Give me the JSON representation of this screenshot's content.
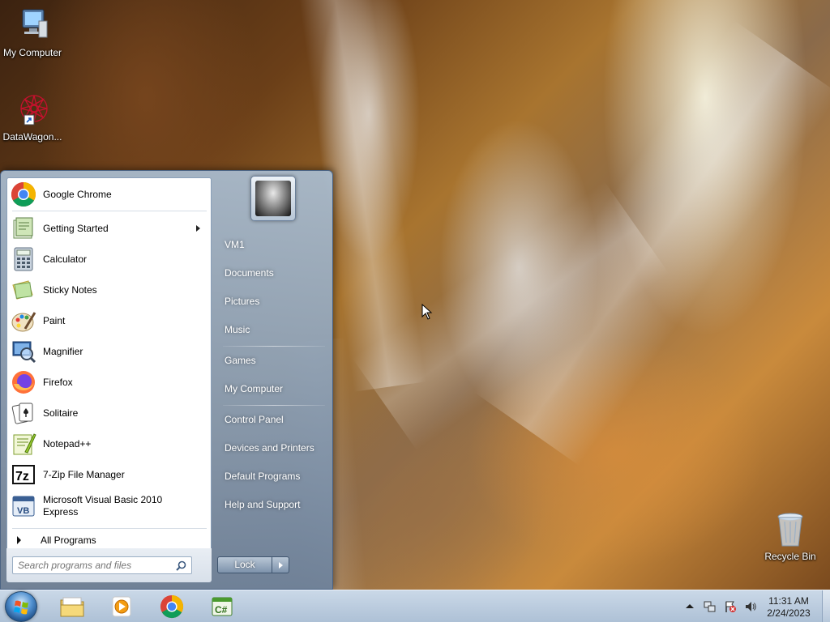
{
  "desktop": {
    "icons": [
      {
        "label": "My Computer",
        "icon": "computer-icon"
      },
      {
        "label": "DataWagon...",
        "icon": "datawagon-shortcut-icon"
      },
      {
        "label": "Recycle Bin",
        "icon": "recycle-bin-icon"
      }
    ]
  },
  "start_menu": {
    "programs": [
      {
        "label": "Google Chrome",
        "icon": "chrome-icon",
        "submenu": false
      },
      {
        "label": "Getting Started",
        "icon": "getting-started-icon",
        "submenu": true
      },
      {
        "label": "Calculator",
        "icon": "calculator-icon",
        "submenu": false
      },
      {
        "label": "Sticky Notes",
        "icon": "sticky-notes-icon",
        "submenu": false
      },
      {
        "label": "Paint",
        "icon": "paint-icon",
        "submenu": false
      },
      {
        "label": "Magnifier",
        "icon": "magnifier-icon",
        "submenu": false
      },
      {
        "label": "Firefox",
        "icon": "firefox-icon",
        "submenu": false
      },
      {
        "label": "Solitaire",
        "icon": "solitaire-icon",
        "submenu": false
      },
      {
        "label": "Notepad++",
        "icon": "notepad-plus-plus-icon",
        "submenu": false
      },
      {
        "label": "7-Zip File Manager",
        "icon": "7zip-icon",
        "submenu": false
      },
      {
        "label_line1": "Microsoft Visual Basic 2010",
        "label_line2": "Express",
        "icon": "visual-basic-icon",
        "submenu": false
      }
    ],
    "all_programs": "All Programs",
    "search_placeholder": "Search programs and files",
    "places": [
      "VM1",
      "Documents",
      "Pictures",
      "Music",
      "Games",
      "My Computer",
      "Control Panel",
      "Devices and Printers",
      "Default Programs",
      "Help and Support"
    ],
    "lock_label": "Lock"
  },
  "taskbar": {
    "pinned": [
      {
        "name": "windows-explorer",
        "icon": "folder-icon"
      },
      {
        "name": "media-player",
        "icon": "media-player-icon"
      },
      {
        "name": "google-chrome",
        "icon": "chrome-icon"
      },
      {
        "name": "visual-csharp",
        "icon": "csharp-icon"
      }
    ],
    "clock": {
      "time": "11:31 AM",
      "date": "2/24/2023"
    }
  }
}
